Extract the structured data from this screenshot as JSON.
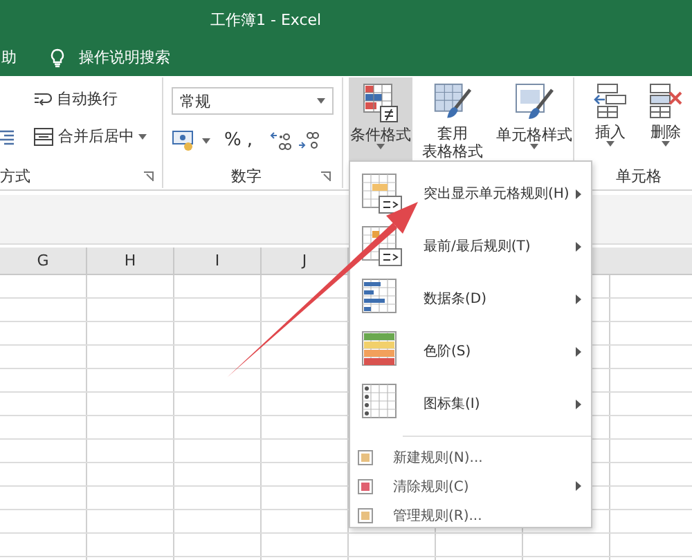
{
  "window": {
    "title": "工作簿1 - Excel"
  },
  "tell_bar": {
    "tab": "助",
    "search": "操作说明搜索"
  },
  "ribbon": {
    "alignment": {
      "wrap": "自动换行",
      "merge": "合并后居中",
      "label": "方式"
    },
    "number": {
      "format": "常规",
      "percent": "%",
      "comma": ",",
      "label": "数字"
    },
    "styles": [
      {
        "lines": [
          "条件格式"
        ],
        "selected": true
      },
      {
        "lines": [
          "套用",
          "表格格式"
        ],
        "selected": false
      },
      {
        "lines": [
          "单元格样式"
        ],
        "selected": false
      }
    ],
    "cells": {
      "buttons": [
        "插入",
        "删除"
      ],
      "label": "单元格"
    }
  },
  "columns": [
    "G",
    "H",
    "I",
    "J"
  ],
  "menu": [
    {
      "kind": "large",
      "label": "突出显示单元格规则(H)",
      "submenu": true
    },
    {
      "kind": "large",
      "label": "最前/最后规则(T)",
      "submenu": true
    },
    {
      "kind": "large",
      "label": "数据条(D)",
      "submenu": true
    },
    {
      "kind": "large",
      "label": "色阶(S)",
      "submenu": true
    },
    {
      "kind": "large",
      "label": "图标集(I)",
      "submenu": true
    },
    {
      "kind": "separator"
    },
    {
      "kind": "small",
      "label": "新建规则(N)...",
      "submenu": false
    },
    {
      "kind": "small",
      "label": "清除规则(C)",
      "submenu": true
    },
    {
      "kind": "small",
      "label": "管理规则(R)...",
      "submenu": false
    }
  ]
}
